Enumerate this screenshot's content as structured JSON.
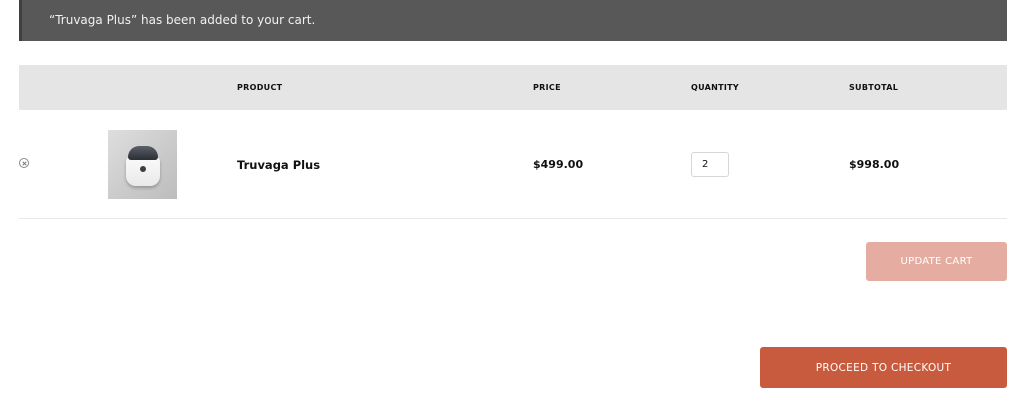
{
  "notice": {
    "message": "“Truvaga Plus” has been added to your cart."
  },
  "table": {
    "headers": {
      "product": "PRODUCT",
      "price": "PRICE",
      "quantity": "QUANTITY",
      "subtotal": "SUBTOTAL"
    },
    "rows": [
      {
        "remove_icon": "close-circle-icon",
        "image_icon": "product-thumbnail",
        "name": "Truvaga Plus",
        "price": "$499.00",
        "quantity": "2",
        "subtotal": "$998.00"
      }
    ]
  },
  "actions": {
    "update_cart": "UPDATE CART",
    "checkout": "PROCEED TO CHECKOUT"
  },
  "colors": {
    "notice_bg": "#585858",
    "header_bg": "#e5e5e5",
    "update_btn": "#e5aca1",
    "checkout_btn": "#c85b3e"
  }
}
